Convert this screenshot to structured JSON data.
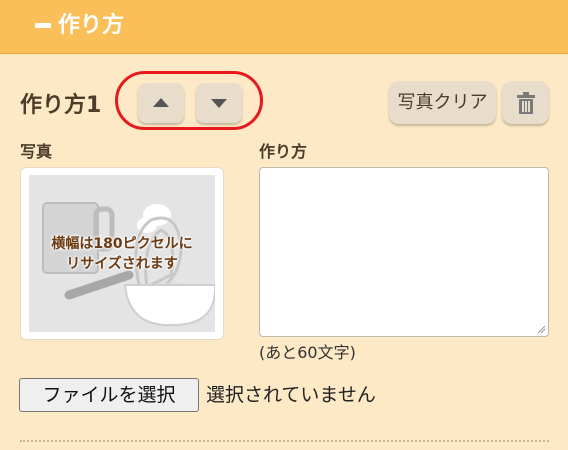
{
  "header": {
    "title": "作り方"
  },
  "step": {
    "title": "作り方1"
  },
  "buttons": {
    "photo_clear": "写真クリア"
  },
  "photo": {
    "label": "写真",
    "placeholder_line1": "横幅は180ピクセルに",
    "placeholder_line2": "リサイズされます"
  },
  "instructions": {
    "label": "作り方",
    "value": "",
    "counter": "(あと60文字)"
  },
  "file": {
    "button_label": "ファイルを選択",
    "status": "選択されていません"
  },
  "colors": {
    "header_bg": "#fbbf5a",
    "page_bg": "#fde9c6",
    "button_bg": "#e8dccb",
    "highlight": "#e8191e",
    "text": "#4b3d2a"
  },
  "icons": [
    "minus-icon",
    "arrow-up-icon",
    "arrow-down-icon",
    "trash-icon",
    "resize-grip-icon"
  ]
}
